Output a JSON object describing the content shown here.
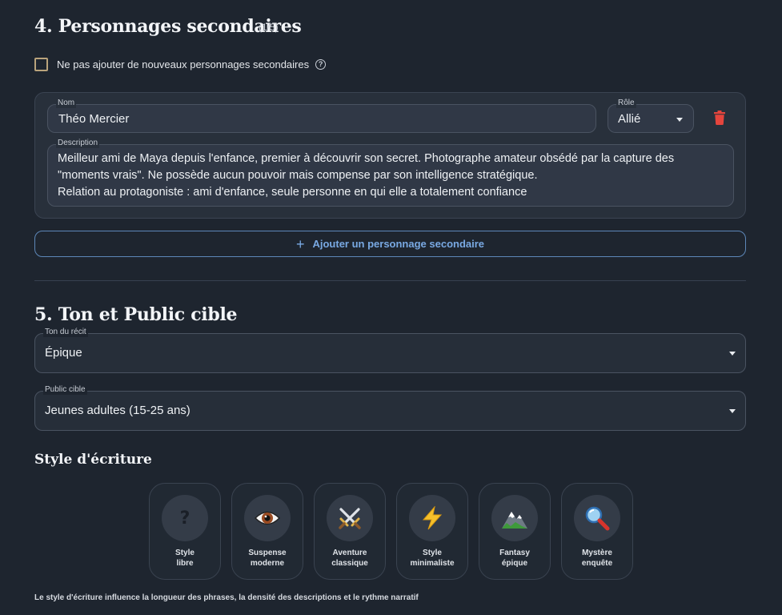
{
  "section4": {
    "title": "4. Personnages secondaires",
    "count": "(1/5)",
    "checkbox_label": "Ne pas ajouter de nouveaux personnages secondaires",
    "help_icon": "?",
    "character": {
      "name_label": "Nom",
      "name_value": "Théo Mercier",
      "role_label": "Rôle",
      "role_value": "Allié",
      "description_label": "Description",
      "description_lines": [
        "Meilleur ami de Maya depuis l'enfance, premier à découvrir son secret. Photographe amateur obsédé par la capture des",
        "\"moments vrais\". Ne possède aucun pouvoir mais compense par son intelligence stratégique.",
        "Relation au protagoniste : ami d'enfance, seule personne en qui elle a totalement confiance"
      ]
    },
    "add_button_icon": "+",
    "add_button_label": "Ajouter un personnage secondaire"
  },
  "section5": {
    "title": "5. Ton et Public cible",
    "tone_label": "Ton du récit",
    "tone_value": "Épique",
    "public_label": "Public cible",
    "public_value": "Jeunes adultes (15-25 ans)",
    "style_title": "Style d'écriture",
    "styles": [
      {
        "icon": "question-icon",
        "glyph": "?",
        "line1": "Style",
        "line2": "libre"
      },
      {
        "icon": "eye-icon",
        "glyph": "👁",
        "line1": "Suspense",
        "line2": "moderne"
      },
      {
        "icon": "crossed-swords-icon",
        "glyph": "⚔",
        "line1": "Aventure",
        "line2": "classique"
      },
      {
        "icon": "lightning-icon",
        "glyph": "⚡",
        "line1": "Style",
        "line2": "minimaliste"
      },
      {
        "icon": "mountain-icon",
        "glyph": "▲",
        "line1": "Fantasy",
        "line2": "épique"
      },
      {
        "icon": "magnifier-icon",
        "glyph": "🔍",
        "line1": "Mystère",
        "line2": "enquête"
      }
    ],
    "footnote": "Le style d'écriture influence la longueur des phrases, la densité des descriptions et le rythme narratif"
  },
  "colors": {
    "background": "#1e252f",
    "accent": "#79a9e3",
    "danger": "#e5453d",
    "checkbox": "#b9a37c"
  }
}
